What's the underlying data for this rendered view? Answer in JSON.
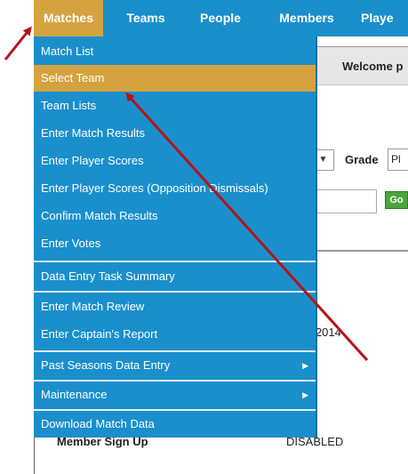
{
  "nav": {
    "items": [
      {
        "label": "Matches"
      },
      {
        "label": "Teams"
      },
      {
        "label": "People"
      },
      {
        "label": "Members"
      },
      {
        "label": "Playe"
      }
    ]
  },
  "background": {
    "welcome_text": "Welcome p",
    "grade_label": "Grade",
    "grade_value": "Pl",
    "go_label": "Go",
    "date_fragment": "pril 2014",
    "member_signup_label": "Member Sign Up",
    "member_signup_status": "DISABLED"
  },
  "menu": {
    "items": [
      {
        "label": "Match List"
      },
      {
        "label": "Select Team"
      },
      {
        "label": "Team Lists"
      },
      {
        "label": "Enter Match Results"
      },
      {
        "label": "Enter Player Scores"
      },
      {
        "label": "Enter Player Scores (Opposition Dismissals)"
      },
      {
        "label": "Confirm Match Results"
      },
      {
        "label": "Enter Votes"
      },
      {
        "label": "Data Entry Task Summary"
      },
      {
        "label": "Enter Match Review"
      },
      {
        "label": "Enter Captain's Report"
      },
      {
        "label": "Past Seasons Data Entry"
      },
      {
        "label": "Maintenance"
      },
      {
        "label": "Download Match Data"
      }
    ]
  },
  "colors": {
    "nav_blue": "#1a8fcc",
    "highlight_gold": "#d4a23f",
    "annotation_red": "#b3141a"
  },
  "icons": {
    "submenu": "triangle-right",
    "select": "triangle-down"
  }
}
